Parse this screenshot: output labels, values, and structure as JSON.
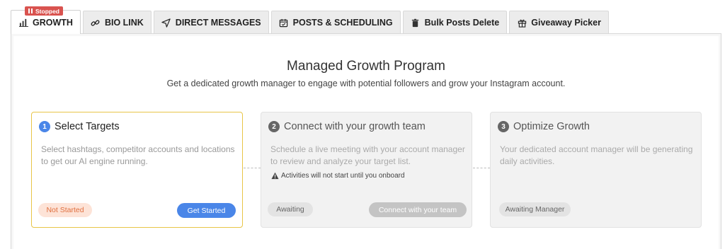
{
  "tabs": [
    {
      "label": "GROWTH",
      "icon": "bar-chart-icon",
      "active": true
    },
    {
      "label": "BIO LINK",
      "icon": "link-icon"
    },
    {
      "label": "DIRECT MESSAGES",
      "icon": "paper-plane-icon"
    },
    {
      "label": "POSTS & SCHEDULING",
      "icon": "calendar-icon"
    },
    {
      "label": "Bulk Posts Delete",
      "icon": "trash-icon"
    },
    {
      "label": "Giveaway Picker",
      "icon": "gift-icon"
    }
  ],
  "badge": {
    "label": "Stopped",
    "color": "#d9534f"
  },
  "main": {
    "title": "Managed Growth Program",
    "subtitle": "Get a dedicated growth manager to engage with potential followers and grow your Instagram account."
  },
  "steps": [
    {
      "number": "1",
      "title": "Select Targets",
      "description": "Select hashtags, competitor accounts and locations to get our AI engine running.",
      "status": "Not Started",
      "action": "Get Started"
    },
    {
      "number": "2",
      "title": "Connect with your growth team",
      "description": "Schedule a live meeting with your account manager to review and analyze your target list.",
      "note": "Activities will not start until you onboard",
      "status": "Awaiting",
      "action": "Connect with your team"
    },
    {
      "number": "3",
      "title": "Optimize Growth",
      "description": "Your dedicated account manager will be generating daily activities.",
      "status": "Awaiting Manager"
    }
  ],
  "colors": {
    "accent": "#4a86e8",
    "active_border": "#e8c547",
    "not_started": "#e07040"
  }
}
